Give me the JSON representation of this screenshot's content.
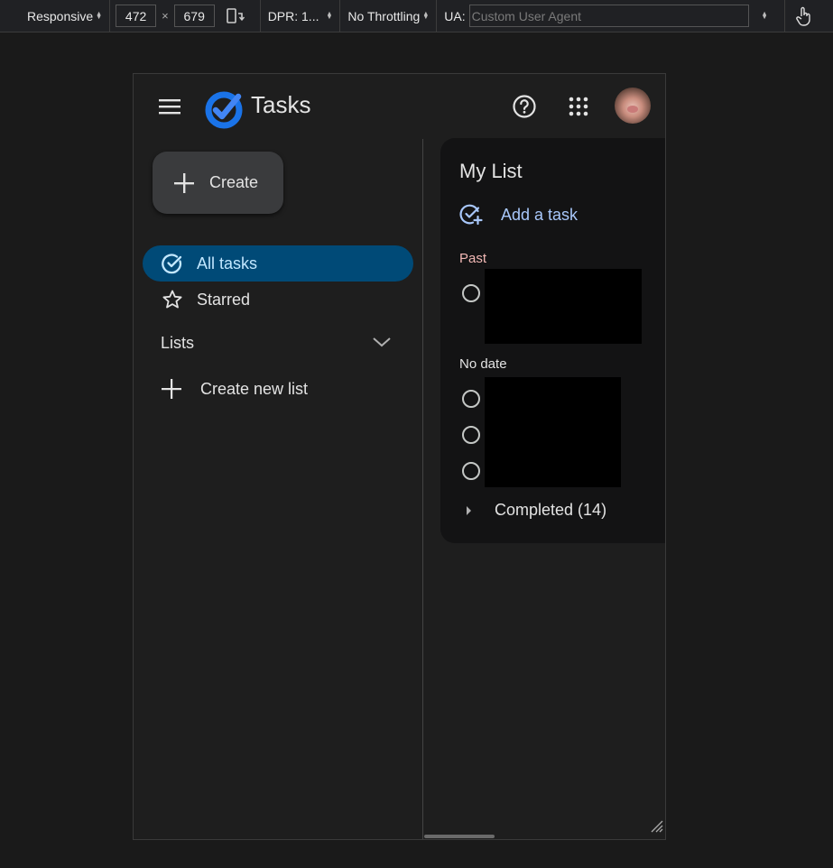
{
  "devtools": {
    "device_mode": "Responsive",
    "width": "472",
    "times": "×",
    "height": "679",
    "dpr": "DPR: 1...",
    "throttling": "No Throttling",
    "ua_label": "UA:",
    "ua_placeholder": "Custom User Agent"
  },
  "app": {
    "title": "Tasks",
    "brand_color": "#1a73e8",
    "create_label": "Create",
    "nav": [
      {
        "label": "All tasks",
        "icon": "check-circle-icon",
        "active": true
      },
      {
        "label": "Starred",
        "icon": "star-icon",
        "active": false
      }
    ],
    "lists_label": "Lists",
    "create_new_list_label": "Create new list"
  },
  "list": {
    "title": "My List",
    "add_task_label": "Add a task",
    "sections": [
      {
        "label": "Past",
        "color": "#f2b8b5"
      },
      {
        "label": "No date",
        "color": "#e3e3e3"
      }
    ],
    "completed_label": "Completed (14)"
  }
}
